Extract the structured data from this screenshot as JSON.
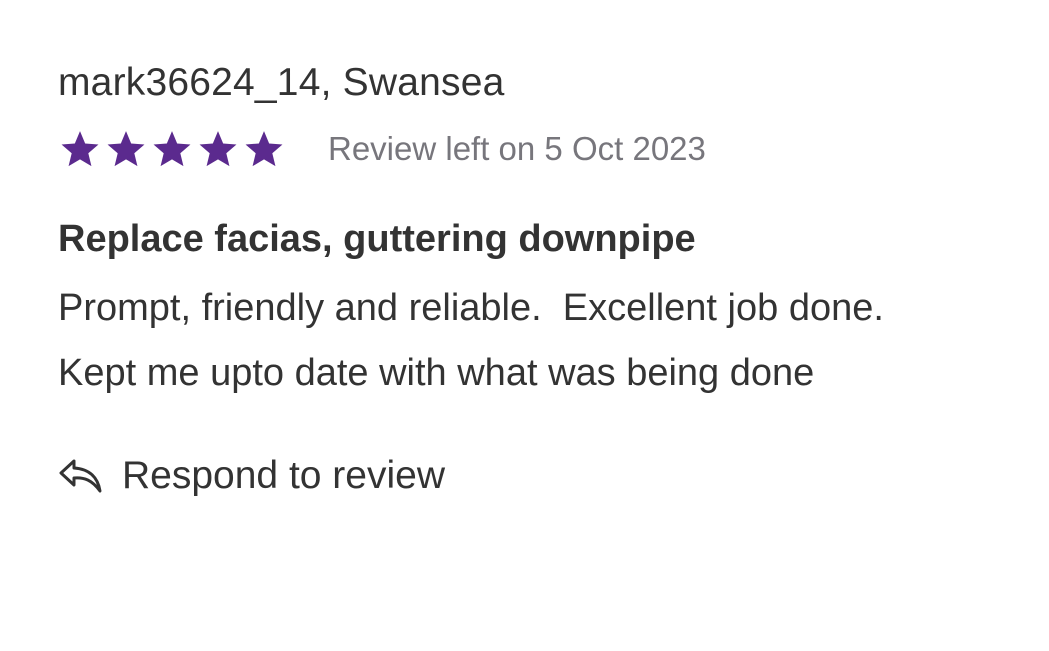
{
  "review": {
    "reviewer": "mark36624_14, Swansea",
    "rating": 5,
    "rating_max": 5,
    "star_color": "#5b2a8e",
    "date_text": "Review left on 5 Oct 2023",
    "title": "Replace facias, guttering downpipe",
    "body": "Prompt, friendly and reliable.  Excellent job done.  Kept me upto date with what was being done"
  },
  "actions": {
    "respond_icon": "reply-icon",
    "respond_label": "Respond to review"
  }
}
